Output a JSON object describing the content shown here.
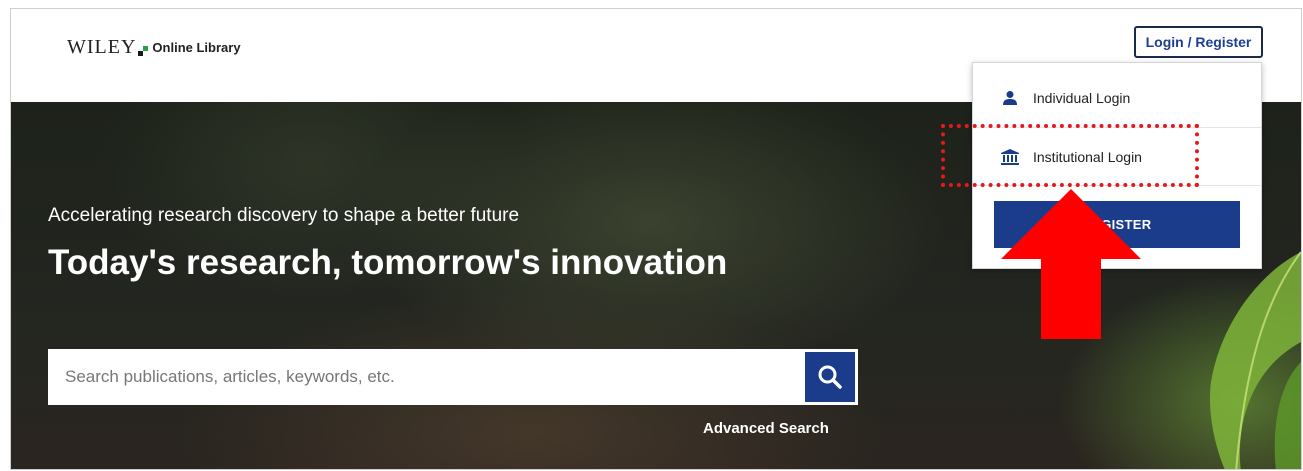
{
  "header": {
    "logo_word": "WILEY",
    "logo_sub": "Online Library",
    "login_register_label": "Login / Register"
  },
  "hero": {
    "tagline": "Accelerating research discovery to shape a better future",
    "headline": "Today's research, tomorrow's innovation"
  },
  "search": {
    "placeholder": "Search publications, articles, keywords, etc.",
    "button_icon": "search-icon",
    "advanced_label": "Advanced Search"
  },
  "dropdown": {
    "items": [
      {
        "label": "Individual Login",
        "icon": "person-icon"
      },
      {
        "label": "Institutional Login",
        "icon": "institution-icon"
      }
    ],
    "register_label": "REGISTER"
  },
  "annotation": {
    "highlight_color": "#e3191b",
    "arrow_color": "#ff0000"
  },
  "colors": {
    "brand_blue": "#1b3c8a",
    "logo_green": "#27a046"
  }
}
